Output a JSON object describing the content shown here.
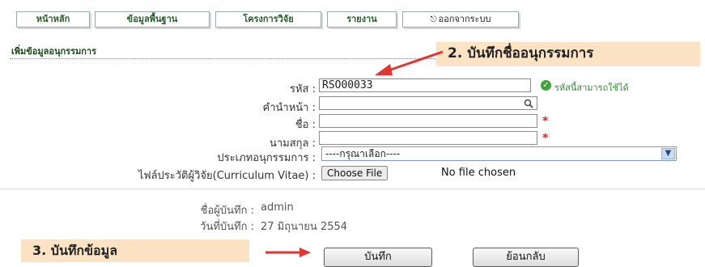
{
  "nav": {
    "tabs": [
      {
        "label": "หน้าหลัก"
      },
      {
        "label": "ข้อมูลพื้นฐาน"
      },
      {
        "label": "โครงการวิจัย"
      },
      {
        "label": "รายงาน"
      },
      {
        "label": "ออกจากระบบ"
      }
    ]
  },
  "section": {
    "title": "เพิ่มข้อมูลอนุกรรมการ"
  },
  "annotations": {
    "step2": "2. บันทึกชื่ออนุกรรมการ",
    "step3": "3. บันทึกข้อมูล"
  },
  "form": {
    "code": {
      "label": "รหัส :",
      "value": "RSO00033",
      "status": "รหัสนี้สามารถใช้ได้"
    },
    "prefix": {
      "label": "คำนำหน้า :",
      "value": ""
    },
    "firstname": {
      "label": "ชื่อ :",
      "value": "",
      "required_mark": "*"
    },
    "lastname": {
      "label": "นามสกุล :",
      "value": "",
      "required_mark": "*"
    },
    "type": {
      "label": "ประเภทอนุกรรมการ :",
      "selected": "----กรุณาเลือก----"
    },
    "cv": {
      "label": "ไฟล์ประวัติผู้วิจัย(Curriculum Vitae) :",
      "button": "Choose File",
      "status": "No file chosen"
    }
  },
  "record_info": {
    "recorder_label": "ชื่อผู้บันทึก :",
    "recorder_value": "admin",
    "date_label": "วันที่บันทึก :",
    "date_value": "27 มิถุนายน 2554"
  },
  "actions": {
    "save": "บันทึก",
    "back": "ย้อนกลับ"
  },
  "colors": {
    "callout": "#fbe3c4",
    "arrow": "#e03535",
    "required": "#e02020",
    "ok": "#3ea53e"
  },
  "icons": {
    "search": "search-icon",
    "ok": "check-circle-icon",
    "logout": "logout-icon"
  }
}
